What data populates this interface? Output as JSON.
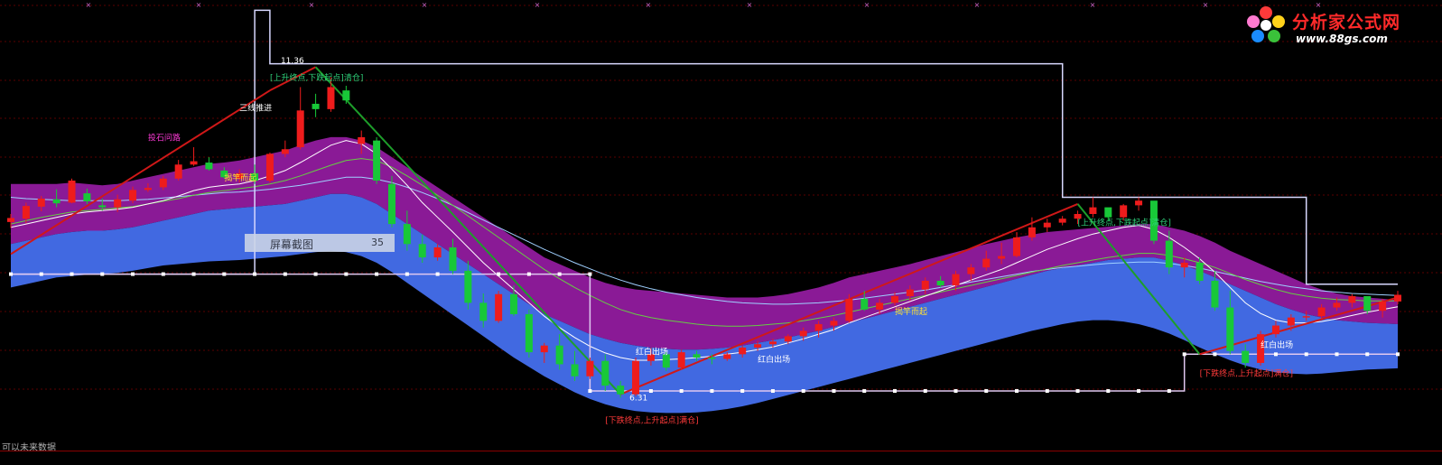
{
  "logo": {
    "title": "分析家公式网",
    "url": "www.88gs.com"
  },
  "tooltip": {
    "label": "屏幕截图",
    "value": "35"
  },
  "footer": {
    "text": "可以未来数据"
  },
  "chart_data": {
    "type": "candlestick",
    "y_range": [
      5.9,
      12.2
    ],
    "n": 92,
    "candles": [
      [
        8.93,
        9.05,
        8.84,
        8.99
      ],
      [
        8.98,
        9.22,
        8.91,
        9.17
      ],
      [
        9.16,
        9.32,
        9.09,
        9.28
      ],
      [
        9.27,
        9.42,
        9.15,
        9.21
      ],
      [
        9.22,
        9.58,
        9.21,
        9.55
      ],
      [
        9.36,
        9.43,
        9.2,
        9.24
      ],
      [
        9.18,
        9.28,
        9.1,
        9.15
      ],
      [
        9.15,
        9.34,
        9.08,
        9.27
      ],
      [
        9.25,
        9.46,
        9.21,
        9.41
      ],
      [
        9.41,
        9.51,
        9.38,
        9.44
      ],
      [
        9.45,
        9.62,
        9.41,
        9.58
      ],
      [
        9.58,
        9.86,
        9.55,
        9.79
      ],
      [
        9.79,
        10.05,
        9.77,
        9.84
      ],
      [
        9.82,
        9.9,
        9.7,
        9.72
      ],
      [
        9.7,
        9.75,
        9.58,
        9.6
      ],
      [
        9.58,
        9.72,
        9.52,
        9.66
      ],
      [
        9.66,
        9.79,
        9.5,
        9.55
      ],
      [
        9.55,
        9.97,
        9.52,
        9.95
      ],
      [
        9.95,
        10.15,
        9.9,
        10.02
      ],
      [
        10.05,
        10.95,
        10.02,
        10.6
      ],
      [
        10.7,
        10.85,
        10.5,
        10.62
      ],
      [
        10.62,
        11.1,
        10.58,
        10.95
      ],
      [
        10.9,
        10.97,
        10.7,
        10.75
      ],
      [
        10.1,
        10.3,
        9.95,
        10.2
      ],
      [
        10.15,
        10.2,
        9.5,
        9.55
      ],
      [
        9.5,
        9.62,
        8.85,
        8.9
      ],
      [
        8.9,
        9.1,
        8.5,
        8.6
      ],
      [
        8.6,
        8.74,
        8.32,
        8.4
      ],
      [
        8.4,
        8.6,
        8.35,
        8.55
      ],
      [
        8.55,
        8.68,
        8.15,
        8.2
      ],
      [
        8.2,
        8.35,
        7.62,
        7.72
      ],
      [
        7.72,
        7.86,
        7.35,
        7.45
      ],
      [
        7.45,
        7.9,
        7.42,
        7.85
      ],
      [
        7.85,
        7.98,
        7.52,
        7.55
      ],
      [
        7.55,
        7.62,
        6.9,
        6.98
      ],
      [
        6.98,
        7.12,
        6.82,
        7.08
      ],
      [
        7.08,
        7.25,
        6.72,
        6.8
      ],
      [
        6.8,
        7.0,
        6.55,
        6.62
      ],
      [
        6.62,
        6.9,
        6.58,
        6.85
      ],
      [
        6.85,
        6.95,
        6.4,
        6.48
      ],
      [
        6.48,
        6.55,
        6.3,
        6.35
      ],
      [
        6.35,
        6.9,
        6.32,
        6.85
      ],
      [
        6.85,
        7.05,
        6.78,
        6.95
      ],
      [
        6.95,
        6.98,
        6.7,
        6.75
      ],
      [
        6.75,
        7.02,
        6.72,
        6.98
      ],
      [
        6.95,
        7.0,
        6.85,
        6.9
      ],
      [
        6.9,
        6.95,
        6.8,
        6.88
      ],
      [
        6.88,
        6.98,
        6.85,
        6.95
      ],
      [
        6.95,
        7.08,
        6.9,
        7.05
      ],
      [
        7.05,
        7.15,
        7.0,
        7.1
      ],
      [
        7.1,
        7.18,
        7.05,
        7.14
      ],
      [
        7.14,
        7.25,
        7.1,
        7.22
      ],
      [
        7.22,
        7.35,
        7.15,
        7.3
      ],
      [
        7.3,
        7.45,
        7.2,
        7.4
      ],
      [
        7.38,
        7.5,
        7.3,
        7.45
      ],
      [
        7.45,
        7.85,
        7.42,
        7.78
      ],
      [
        7.78,
        7.9,
        7.6,
        7.62
      ],
      [
        7.62,
        7.78,
        7.55,
        7.72
      ],
      [
        7.72,
        7.88,
        7.68,
        7.82
      ],
      [
        7.82,
        7.98,
        7.75,
        7.92
      ],
      [
        7.92,
        8.1,
        7.85,
        8.05
      ],
      [
        8.05,
        8.12,
        7.95,
        7.98
      ],
      [
        7.98,
        8.2,
        7.9,
        8.15
      ],
      [
        8.15,
        8.3,
        8.05,
        8.25
      ],
      [
        8.25,
        8.5,
        8.2,
        8.38
      ],
      [
        8.38,
        8.62,
        8.3,
        8.42
      ],
      [
        8.42,
        8.78,
        8.4,
        8.7
      ],
      [
        8.7,
        9.0,
        8.65,
        8.85
      ],
      [
        8.85,
        8.98,
        8.78,
        8.92
      ],
      [
        8.92,
        9.02,
        8.88,
        8.98
      ],
      [
        8.98,
        9.1,
        8.9,
        9.05
      ],
      [
        9.05,
        9.3,
        9.0,
        9.15
      ],
      [
        9.15,
        9.12,
        8.95,
        9.0
      ],
      [
        9.0,
        9.2,
        8.95,
        9.18
      ],
      [
        9.18,
        9.3,
        9.1,
        9.25
      ],
      [
        9.25,
        9.2,
        8.6,
        8.65
      ],
      [
        8.65,
        8.8,
        8.15,
        8.25
      ],
      [
        8.25,
        8.4,
        8.1,
        8.32
      ],
      [
        8.32,
        8.4,
        8.0,
        8.05
      ],
      [
        8.05,
        8.2,
        7.6,
        7.65
      ],
      [
        7.65,
        7.9,
        6.95,
        7.0
      ],
      [
        7.0,
        7.1,
        6.75,
        6.82
      ],
      [
        6.82,
        7.3,
        6.78,
        7.25
      ],
      [
        7.25,
        7.45,
        7.2,
        7.38
      ],
      [
        7.38,
        7.55,
        7.3,
        7.5
      ],
      [
        7.5,
        7.6,
        7.45,
        7.52
      ],
      [
        7.52,
        7.7,
        7.48,
        7.65
      ],
      [
        7.65,
        7.8,
        7.6,
        7.72
      ],
      [
        7.72,
        7.85,
        7.65,
        7.82
      ],
      [
        7.82,
        7.75,
        7.55,
        7.6
      ],
      [
        7.6,
        7.78,
        7.5,
        7.74
      ],
      [
        7.74,
        7.9,
        7.7,
        7.84
      ]
    ],
    "purple_upper": [
      9.5,
      9.5,
      9.5,
      9.5,
      9.52,
      9.5,
      9.48,
      9.5,
      9.55,
      9.6,
      9.65,
      9.7,
      9.75,
      9.8,
      9.82,
      9.85,
      9.9,
      9.95,
      10.0,
      10.08,
      10.15,
      10.2,
      10.2,
      10.15,
      10.05,
      9.9,
      9.75,
      9.6,
      9.45,
      9.3,
      9.15,
      9.0,
      8.85,
      8.7,
      8.55,
      8.4,
      8.3,
      8.2,
      8.1,
      8.02,
      7.96,
      7.92,
      7.9,
      7.88,
      7.86,
      7.84,
      7.82,
      7.8,
      7.8,
      7.8,
      7.82,
      7.85,
      7.9,
      7.95,
      8.02,
      8.1,
      8.15,
      8.2,
      8.25,
      8.3,
      8.36,
      8.42,
      8.48,
      8.54,
      8.6,
      8.65,
      8.7,
      8.74,
      8.78,
      8.8,
      8.82,
      8.84,
      8.86,
      8.88,
      8.9,
      8.9,
      8.85,
      8.8,
      8.72,
      8.62,
      8.5,
      8.4,
      8.3,
      8.2,
      8.1,
      8.0,
      7.92,
      7.86,
      7.82,
      7.8,
      7.78,
      7.76
    ],
    "band_mid": [
      8.6,
      8.65,
      8.7,
      8.75,
      8.78,
      8.8,
      8.8,
      8.82,
      8.85,
      8.9,
      8.95,
      9.0,
      9.05,
      9.1,
      9.12,
      9.14,
      9.16,
      9.18,
      9.2,
      9.25,
      9.3,
      9.35,
      9.35,
      9.3,
      9.2,
      9.05,
      8.9,
      8.75,
      8.6,
      8.45,
      8.3,
      8.15,
      8.0,
      7.85,
      7.7,
      7.55,
      7.45,
      7.35,
      7.25,
      7.18,
      7.12,
      7.08,
      7.05,
      7.03,
      7.02,
      7.02,
      7.03,
      7.05,
      7.08,
      7.12,
      7.16,
      7.2,
      7.25,
      7.3,
      7.36,
      7.42,
      7.48,
      7.54,
      7.6,
      7.66,
      7.72,
      7.78,
      7.84,
      7.9,
      7.96,
      8.02,
      8.08,
      8.14,
      8.2,
      8.24,
      8.28,
      8.32,
      8.36,
      8.38,
      8.4,
      8.4,
      8.35,
      8.28,
      8.2,
      8.1,
      8.0,
      7.9,
      7.8,
      7.7,
      7.62,
      7.55,
      7.5,
      7.46,
      7.44,
      7.42,
      7.41,
      7.4
    ],
    "blue_lower": [
      7.95,
      8.0,
      8.05,
      8.1,
      8.12,
      8.14,
      8.15,
      8.17,
      8.2,
      8.24,
      8.28,
      8.3,
      8.32,
      8.34,
      8.35,
      8.36,
      8.38,
      8.4,
      8.42,
      8.45,
      8.48,
      8.5,
      8.48,
      8.42,
      8.32,
      8.18,
      8.02,
      7.86,
      7.7,
      7.54,
      7.38,
      7.22,
      7.06,
      6.9,
      6.76,
      6.62,
      6.5,
      6.38,
      6.28,
      6.2,
      6.14,
      6.1,
      6.08,
      6.07,
      6.07,
      6.08,
      6.1,
      6.13,
      6.17,
      6.22,
      6.28,
      6.34,
      6.4,
      6.46,
      6.52,
      6.58,
      6.64,
      6.7,
      6.76,
      6.82,
      6.88,
      6.94,
      7.0,
      7.06,
      7.12,
      7.18,
      7.24,
      7.3,
      7.35,
      7.4,
      7.44,
      7.46,
      7.46,
      7.44,
      7.4,
      7.34,
      7.26,
      7.16,
      7.05,
      6.95,
      6.86,
      6.78,
      6.72,
      6.68,
      6.66,
      6.65,
      6.66,
      6.68,
      6.7,
      6.72,
      6.73,
      6.74
    ],
    "ma_white": [
      8.85,
      8.9,
      8.95,
      9.0,
      9.05,
      9.08,
      9.1,
      9.12,
      9.15,
      9.2,
      9.25,
      9.32,
      9.4,
      9.45,
      9.48,
      9.5,
      9.55,
      9.62,
      9.7,
      9.82,
      9.95,
      10.08,
      10.15,
      10.1,
      9.95,
      9.72,
      9.48,
      9.22,
      9.0,
      8.78,
      8.55,
      8.32,
      8.12,
      7.92,
      7.72,
      7.52,
      7.35,
      7.2,
      7.07,
      6.97,
      6.9,
      6.86,
      6.86,
      6.87,
      6.88,
      6.9,
      6.92,
      6.95,
      6.98,
      7.02,
      7.06,
      7.12,
      7.18,
      7.25,
      7.32,
      7.42,
      7.5,
      7.58,
      7.66,
      7.74,
      7.82,
      7.9,
      7.98,
      8.06,
      8.14,
      8.22,
      8.32,
      8.42,
      8.52,
      8.6,
      8.68,
      8.75,
      8.8,
      8.85,
      8.88,
      8.82,
      8.7,
      8.55,
      8.38,
      8.18,
      7.95,
      7.72,
      7.56,
      7.46,
      7.42,
      7.42,
      7.44,
      7.48,
      7.53,
      7.58,
      7.62,
      7.66
    ],
    "ma_green": [
      8.9,
      8.95,
      9.0,
      9.04,
      9.08,
      9.1,
      9.12,
      9.14,
      9.16,
      9.2,
      9.24,
      9.28,
      9.33,
      9.37,
      9.4,
      9.43,
      9.46,
      9.5,
      9.55,
      9.62,
      9.7,
      9.78,
      9.85,
      9.88,
      9.85,
      9.75,
      9.62,
      9.48,
      9.33,
      9.18,
      9.02,
      8.86,
      8.7,
      8.54,
      8.38,
      8.22,
      8.08,
      7.95,
      7.83,
      7.72,
      7.62,
      7.55,
      7.5,
      7.46,
      7.43,
      7.4,
      7.38,
      7.37,
      7.37,
      7.38,
      7.4,
      7.42,
      7.45,
      7.49,
      7.53,
      7.58,
      7.63,
      7.68,
      7.73,
      7.78,
      7.83,
      7.88,
      7.93,
      7.98,
      8.03,
      8.08,
      8.13,
      8.18,
      8.23,
      8.28,
      8.32,
      8.36,
      8.4,
      8.43,
      8.46,
      8.46,
      8.43,
      8.38,
      8.32,
      8.25,
      8.16,
      8.07,
      7.99,
      7.92,
      7.86,
      7.82,
      7.79,
      7.77,
      7.76,
      7.75,
      7.75,
      7.75
    ],
    "ma_lightblue": [
      9.3,
      9.28,
      9.27,
      9.26,
      9.25,
      9.25,
      9.25,
      9.25,
      9.26,
      9.27,
      9.29,
      9.31,
      9.33,
      9.35,
      9.37,
      9.38,
      9.4,
      9.42,
      9.45,
      9.48,
      9.52,
      9.56,
      9.6,
      9.6,
      9.57,
      9.52,
      9.45,
      9.37,
      9.28,
      9.18,
      9.07,
      8.96,
      8.85,
      8.74,
      8.63,
      8.52,
      8.42,
      8.32,
      8.23,
      8.14,
      8.06,
      7.99,
      7.93,
      7.88,
      7.84,
      7.8,
      7.77,
      7.74,
      7.72,
      7.71,
      7.7,
      7.7,
      7.71,
      7.72,
      7.74,
      7.76,
      7.79,
      7.82,
      7.85,
      7.88,
      7.91,
      7.95,
      7.99,
      8.03,
      8.07,
      8.11,
      8.15,
      8.19,
      8.22,
      8.25,
      8.27,
      8.29,
      8.31,
      8.32,
      8.33,
      8.33,
      8.31,
      8.28,
      8.24,
      8.19,
      8.14,
      8.09,
      8.04,
      8.0,
      7.96,
      7.93,
      7.9,
      7.88,
      7.86,
      7.85,
      7.84,
      7.83
    ],
    "zigzag": [
      [
        0,
        8.45
      ],
      [
        17,
        10.9
      ],
      [
        20,
        11.25
      ],
      [
        40,
        6.35
      ],
      [
        70,
        9.2
      ],
      [
        78,
        6.95
      ],
      [
        91,
        7.8
      ]
    ],
    "high_mark": {
      "index": 17,
      "value": "11.36"
    },
    "low_mark": {
      "index": 40,
      "value": "6.31"
    },
    "step_line": [
      [
        0,
        8.15
      ],
      [
        16,
        8.15
      ],
      [
        16,
        12.1
      ],
      [
        17,
        12.1
      ],
      [
        17,
        11.3
      ],
      [
        69,
        11.3
      ],
      [
        69,
        9.3
      ],
      [
        85,
        9.3
      ],
      [
        85,
        8.0
      ],
      [
        91,
        8.0
      ]
    ],
    "lower_step": [
      [
        0,
        8.15
      ],
      [
        38,
        8.15
      ],
      [
        38,
        6.4
      ],
      [
        77,
        6.4
      ],
      [
        77,
        6.95
      ],
      [
        91,
        6.95
      ]
    ],
    "annotations": [
      {
        "text": "[上升终点,下跌起点]清仓]",
        "color": "#2fd17a",
        "i": 17,
        "y": 11.05
      },
      {
        "text": "三线推进",
        "color": "#ffffff",
        "i": 15,
        "y": 10.6
      },
      {
        "text": "投石问路",
        "color": "#ff3ad8",
        "i": 9,
        "y": 10.15
      },
      {
        "text": "揭竿而起",
        "color": "#ffe030",
        "i": 14,
        "y": 9.55
      },
      {
        "text": "[上升终点,下跌起点]清仓]",
        "color": "#2fd17a",
        "i": 70,
        "y": 8.88
      },
      {
        "text": "揭竿而起",
        "color": "#ffe030",
        "i": 58,
        "y": 7.55
      },
      {
        "text": "红白出场",
        "color": "#ffffff",
        "i": 41,
        "y": 6.95
      },
      {
        "text": "红白出场",
        "color": "#ffffff",
        "i": 49,
        "y": 6.83
      },
      {
        "text": "红白出场",
        "color": "#ffffff",
        "i": 82,
        "y": 7.05
      },
      {
        "text": "[下跌终点,上升起点]满仓]",
        "color": "#ff3a3a",
        "i": 39,
        "y": 5.92
      },
      {
        "text": "[下跌终点,上升起点]满仓]",
        "color": "#ff3a3a",
        "i": 78,
        "y": 6.62
      }
    ]
  }
}
